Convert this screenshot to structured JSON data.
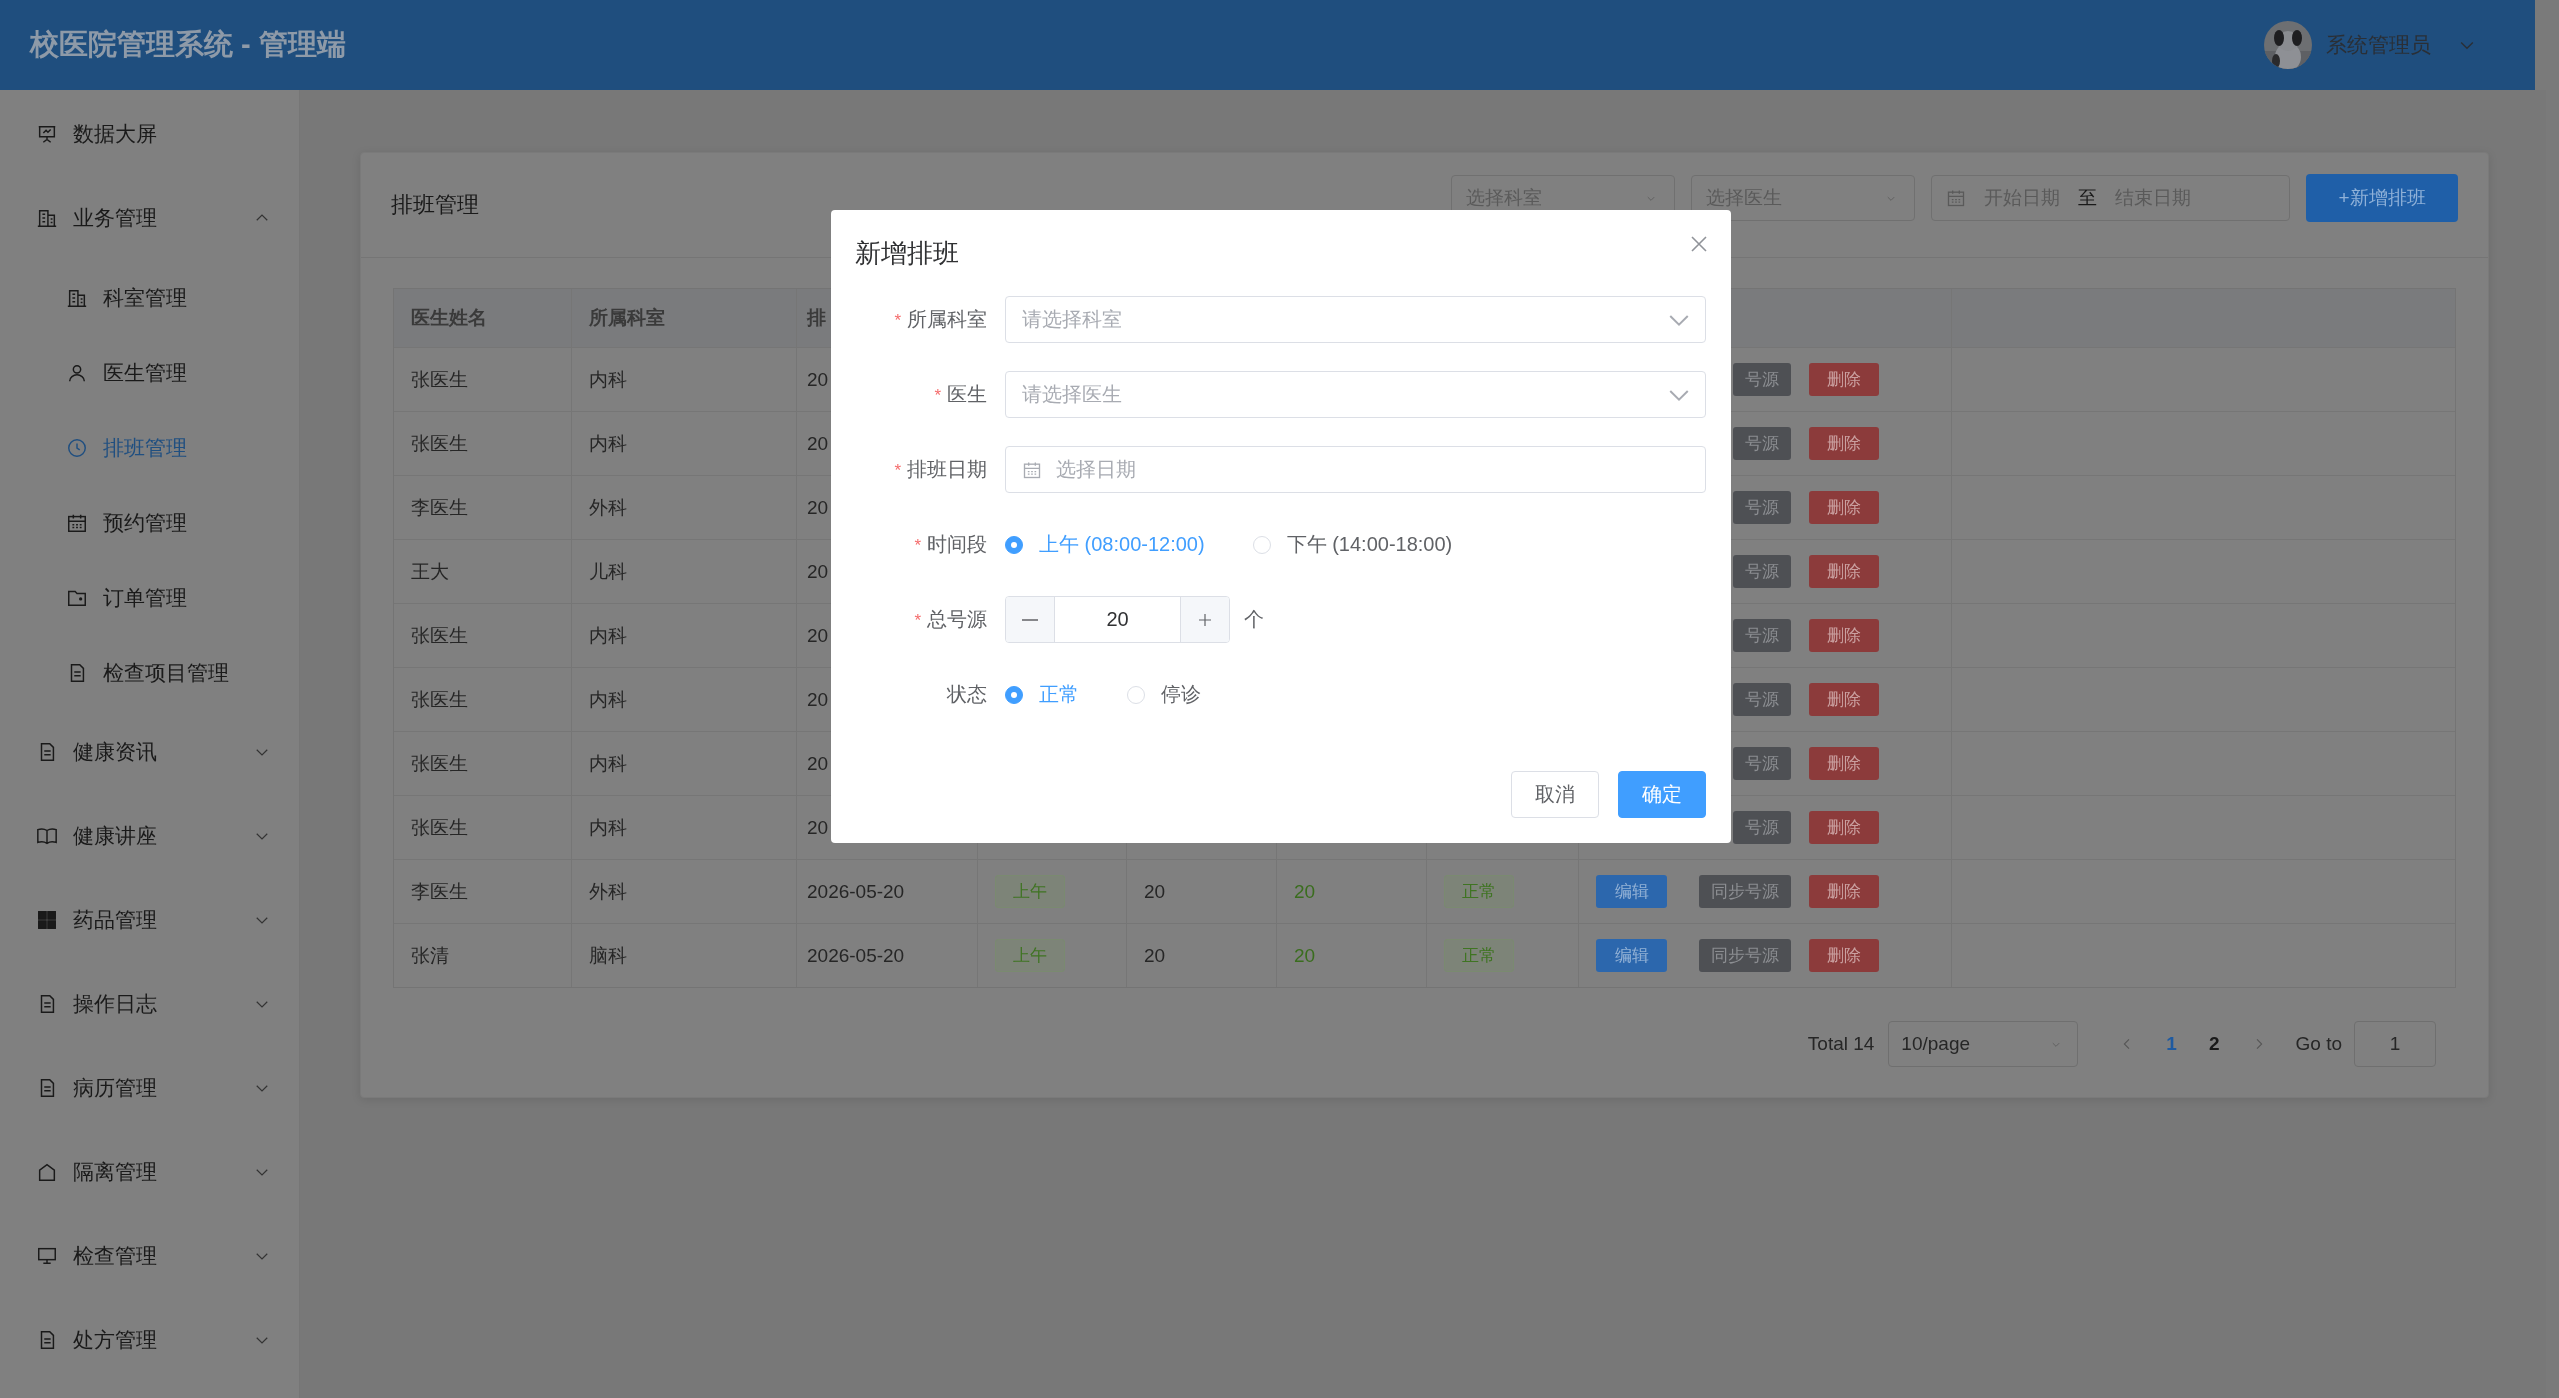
{
  "header": {
    "title": "校医院管理系统 - 管理端",
    "user": {
      "name": "系统管理员"
    }
  },
  "sidebar": {
    "items": [
      {
        "label": "数据大屏",
        "selected": false
      },
      {
        "label": "业务管理",
        "selected": false,
        "expanded": true,
        "children": [
          {
            "label": "科室管理",
            "selected": false
          },
          {
            "label": "医生管理",
            "selected": false
          },
          {
            "label": "排班管理",
            "selected": true
          },
          {
            "label": "预约管理",
            "selected": false
          },
          {
            "label": "订单管理",
            "selected": false
          },
          {
            "label": "检查项目管理",
            "selected": false
          }
        ]
      },
      {
        "label": "健康资讯",
        "selected": false,
        "expanded": false
      },
      {
        "label": "健康讲座",
        "selected": false,
        "expanded": false
      },
      {
        "label": "药品管理",
        "selected": false,
        "expanded": false
      },
      {
        "label": "操作日志",
        "selected": false,
        "expanded": false
      },
      {
        "label": "病历管理",
        "selected": false,
        "expanded": false
      },
      {
        "label": "隔离管理",
        "selected": false,
        "expanded": false
      },
      {
        "label": "检查管理",
        "selected": false,
        "expanded": false
      },
      {
        "label": "处方管理",
        "selected": false,
        "expanded": false
      }
    ]
  },
  "page": {
    "title": "排班管理",
    "filters": {
      "department_select": {
        "placeholder": "选择科室"
      },
      "doctor_select": {
        "placeholder": "选择医生"
      },
      "date_range": {
        "start_placeholder": "开始日期",
        "separator": "至",
        "end_placeholder": "结束日期"
      }
    },
    "add_button": "+新增排班"
  },
  "table": {
    "columns": [
      "医生姓名",
      "所属科室",
      "排"
    ],
    "rows": [
      {
        "name": "张医生",
        "department": "内科",
        "date": "20",
        "actions": [
          {
            "kind": "sync",
            "label": "号源"
          },
          {
            "kind": "delete",
            "label": "删除"
          }
        ]
      },
      {
        "name": "张医生",
        "department": "内科",
        "date": "20",
        "actions": [
          {
            "kind": "sync",
            "label": "号源"
          },
          {
            "kind": "delete",
            "label": "删除"
          }
        ]
      },
      {
        "name": "李医生",
        "department": "外科",
        "date": "20",
        "actions": [
          {
            "kind": "sync",
            "label": "号源"
          },
          {
            "kind": "delete",
            "label": "删除"
          }
        ]
      },
      {
        "name": "王大",
        "department": "儿科",
        "date": "20",
        "actions": [
          {
            "kind": "sync",
            "label": "号源"
          },
          {
            "kind": "delete",
            "label": "删除"
          }
        ]
      },
      {
        "name": "张医生",
        "department": "内科",
        "date": "20",
        "actions": [
          {
            "kind": "sync",
            "label": "号源"
          },
          {
            "kind": "delete",
            "label": "删除"
          }
        ]
      },
      {
        "name": "张医生",
        "department": "内科",
        "date": "20",
        "actions": [
          {
            "kind": "sync",
            "label": "号源"
          },
          {
            "kind": "delete",
            "label": "删除"
          }
        ]
      },
      {
        "name": "张医生",
        "department": "内科",
        "date": "20",
        "actions": [
          {
            "kind": "sync",
            "label": "号源"
          },
          {
            "kind": "delete",
            "label": "删除"
          }
        ]
      },
      {
        "name": "张医生",
        "department": "内科",
        "date": "20",
        "actions": [
          {
            "kind": "sync",
            "label": "号源"
          },
          {
            "kind": "delete",
            "label": "删除"
          }
        ]
      },
      {
        "name": "李医生",
        "department": "外科",
        "date": "2026-05-20",
        "slot": "上午",
        "total": "20",
        "remaining": "20",
        "status": "正常",
        "actions": [
          {
            "kind": "edit",
            "label": "编辑"
          },
          {
            "kind": "sync",
            "label": "同步号源"
          },
          {
            "kind": "delete",
            "label": "删除"
          }
        ]
      },
      {
        "name": "张清",
        "department": "脑科",
        "date": "2026-05-20",
        "slot": "上午",
        "total": "20",
        "remaining": "20",
        "status": "正常",
        "actions": [
          {
            "kind": "edit",
            "label": "编辑"
          },
          {
            "kind": "sync",
            "label": "同步号源"
          },
          {
            "kind": "delete",
            "label": "删除"
          }
        ]
      }
    ]
  },
  "pagination": {
    "total": "Total 14",
    "page_size": "10/page",
    "pages": [
      {
        "label": "1",
        "selected": true
      },
      {
        "label": "2",
        "selected": false
      }
    ],
    "goto_label": "Go to",
    "goto_value": "1"
  },
  "dialog": {
    "title": "新增排班",
    "fields": [
      {
        "kind": "select",
        "label": "所属科室",
        "required_mark": "*",
        "placeholder": "请选择科室"
      },
      {
        "kind": "select",
        "label": "医生",
        "required_mark": "*",
        "placeholder": "请选择医生"
      },
      {
        "kind": "date",
        "label": "排班日期",
        "required_mark": "*",
        "placeholder": "选择日期"
      },
      {
        "kind": "radio",
        "label": "时间段",
        "required_mark": "*",
        "options": [
          {
            "label": "上午 (08:00-12:00)",
            "selected": true
          },
          {
            "label": "下午 (14:00-18:00)",
            "selected": false
          }
        ]
      },
      {
        "kind": "number",
        "label": "总号源",
        "required_mark": "*",
        "value": "20",
        "unit": "个"
      },
      {
        "kind": "radio",
        "label": "状态",
        "options": [
          {
            "label": "正常",
            "selected": true
          },
          {
            "label": "停诊",
            "selected": false
          }
        ]
      }
    ],
    "buttons": [
      {
        "kind": "cancel",
        "label": "取消"
      },
      {
        "kind": "confirm",
        "label": "确定"
      }
    ]
  }
}
